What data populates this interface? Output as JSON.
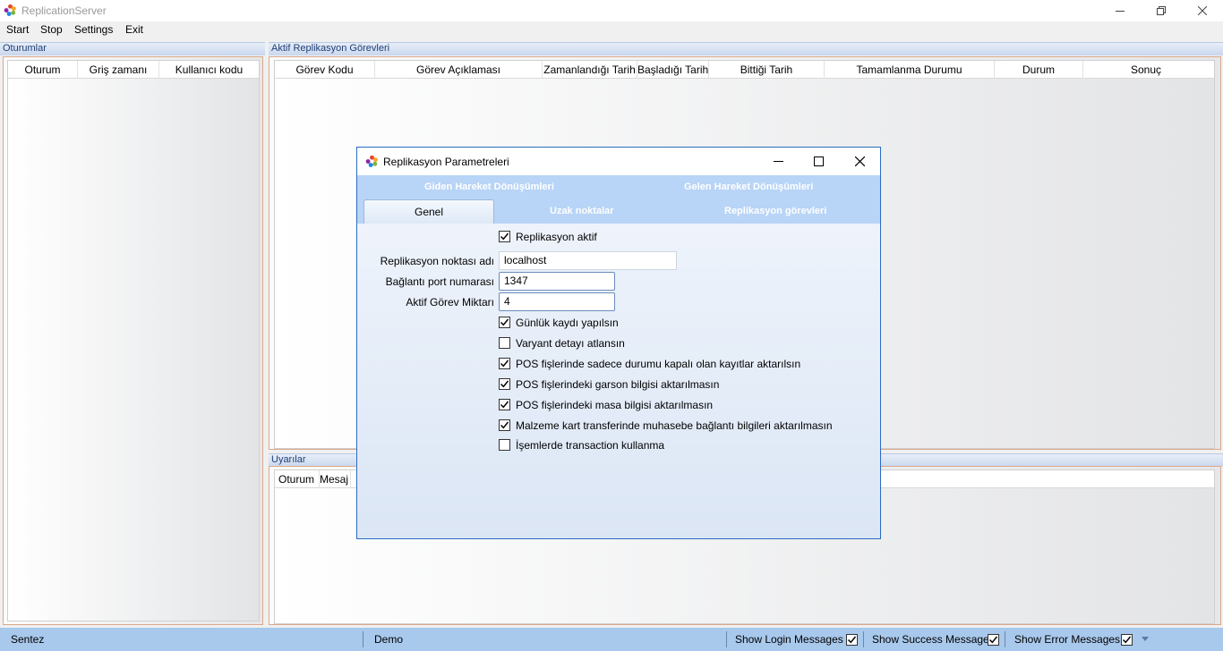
{
  "window": {
    "title": "ReplicationServer"
  },
  "menu": {
    "items": [
      "Start",
      "Stop",
      "Settings",
      "Exit"
    ]
  },
  "sessions": {
    "title": "Oturumlar",
    "columns": [
      "Oturum",
      "Griş zamanı",
      "Kullanıcı kodu"
    ]
  },
  "tasks": {
    "title": "Aktif Replikasyon Görevleri",
    "columns": [
      "Görev Kodu",
      "Görev Açıklaması",
      "Zamanlandığı Tarih",
      "Başladığı Tarih",
      "Bittiği Tarih",
      "Tamamlanma Durumu",
      "Durum",
      "Sonuç"
    ]
  },
  "warnings": {
    "title": "Uyarılar",
    "columns": [
      "Oturum",
      "Mesaj"
    ]
  },
  "statusbar": {
    "company": "Sentez",
    "mode": "Demo",
    "show_login": {
      "label": "Show Login Messages",
      "checked": true
    },
    "show_success": {
      "label": "Show Success Message",
      "checked": true
    },
    "show_error": {
      "label": "Show Error Messages",
      "checked": true
    },
    "dropdown_icon": "chevron-down-icon"
  },
  "dialog": {
    "title": "Replikasyon Parametreleri",
    "tabs_row1": [
      "Giden Hareket Dönüşümleri",
      "Gelen Hareket Dönüşümleri"
    ],
    "tabs_row2": [
      "Genel",
      "Uzak noktalar",
      "Replikasyon görevleri"
    ],
    "active_tab": "Genel",
    "replication_active": {
      "label": "Replikasyon aktif",
      "checked": true
    },
    "fields": {
      "point_name": {
        "label": "Replikasyon noktası adı",
        "value": "localhost"
      },
      "port": {
        "label": "Bağlantı port numarası",
        "value": "1347"
      },
      "task_count": {
        "label": "Aktif Görev Miktarı",
        "value": "4"
      }
    },
    "options": [
      {
        "label": "Günlük kaydı yapılsın",
        "checked": true
      },
      {
        "label": "Varyant detayı atlansın",
        "checked": false
      },
      {
        "label": "POS fişlerinde sadece durumu kapalı olan kayıtlar aktarılsın",
        "checked": true
      },
      {
        "label": "POS fişlerindeki garson bilgisi aktarılmasın",
        "checked": true
      },
      {
        "label": "POS fişlerindeki masa bilgisi aktarılmasın",
        "checked": true
      },
      {
        "label": "Malzeme kart transferinde muhasebe bağlantı bilgileri aktarılmasın",
        "checked": true
      },
      {
        "label": "İşemlerde transaction kullanma",
        "checked": false
      }
    ]
  },
  "colors": {
    "accent": "#2b6bc0",
    "statusbar": "#a8c8ec",
    "group_border": "#dba88b"
  }
}
